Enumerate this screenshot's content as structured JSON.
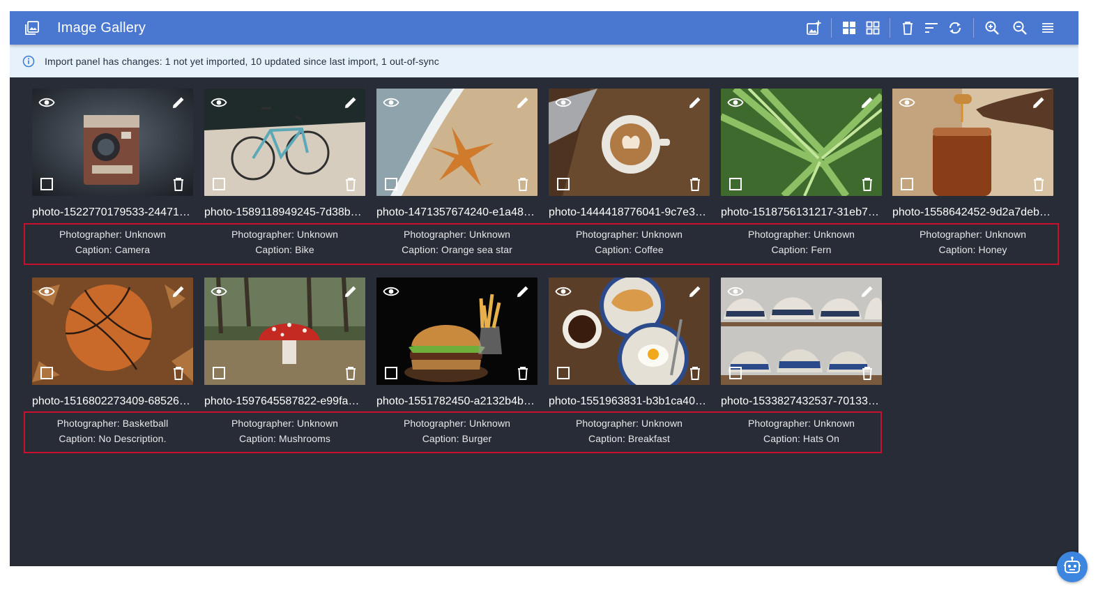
{
  "app": {
    "title": "Image Gallery",
    "icon": "image-library-icon",
    "accent_color": "#4a78d0",
    "background_color": "#282c36"
  },
  "toolbar": {
    "buttons": [
      {
        "name": "add-image-button",
        "icon": "add-photo-icon"
      },
      {
        "name": "large-grid-button",
        "icon": "grid-large-icon"
      },
      {
        "name": "small-grid-button",
        "icon": "grid-small-icon"
      },
      {
        "name": "delete-button",
        "icon": "trash-icon"
      },
      {
        "name": "sort-button",
        "icon": "sort-icon"
      },
      {
        "name": "sync-button",
        "icon": "sync-icon"
      },
      {
        "name": "zoom-in-button",
        "icon": "zoom-in-icon"
      },
      {
        "name": "zoom-out-button",
        "icon": "zoom-out-icon"
      },
      {
        "name": "menu-button",
        "icon": "hamburger-menu-icon"
      }
    ]
  },
  "banner": {
    "icon": "info-icon",
    "text": "Import panel has changes: 1 not yet imported, 10 updated since last import, 1 out-of-sync",
    "background_color": "#e6f1fb"
  },
  "images": [
    {
      "filename": "photo-1522770179533-24471f…",
      "photographer": "Photographer: Unknown",
      "caption": "Caption: Camera",
      "subject": "camera"
    },
    {
      "filename": "photo-1589118949245-7d38b…",
      "photographer": "Photographer: Unknown",
      "caption": "Caption: Bike",
      "subject": "bike"
    },
    {
      "filename": "photo-1471357674240-e1a48…",
      "photographer": "Photographer: Unknown",
      "caption": "Caption: Orange sea star",
      "subject": "sea-star"
    },
    {
      "filename": "photo-1444418776041-9c7e3…",
      "photographer": "Photographer: Unknown",
      "caption": "Caption: Coffee",
      "subject": "coffee"
    },
    {
      "filename": "photo-1518756131217-31eb7…",
      "photographer": "Photographer: Unknown",
      "caption": "Caption: Fern",
      "subject": "fern"
    },
    {
      "filename": "photo-1558642452-9d2a7deb…",
      "photographer": "Photographer: Unknown",
      "caption": "Caption: Honey",
      "subject": "honey"
    },
    {
      "filename": "photo-1516802273409-68526…",
      "photographer": "Photographer: Basketball",
      "caption": "Caption: No Description.",
      "subject": "basketball"
    },
    {
      "filename": "photo-1597645587822-e99fa5…",
      "photographer": "Photographer: Unknown",
      "caption": "Caption: Mushrooms",
      "subject": "mushroom"
    },
    {
      "filename": "photo-1551782450-a2132b4b…",
      "photographer": "Photographer: Unknown",
      "caption": "Caption: Burger",
      "subject": "burger"
    },
    {
      "filename": "photo-1551963831-b3b1ca40…",
      "photographer": "Photographer: Unknown",
      "caption": "Caption: Breakfast",
      "subject": "breakfast"
    },
    {
      "filename": "photo-1533827432537-70133…",
      "photographer": "Photographer: Unknown",
      "caption": "Caption: Hats On",
      "subject": "hats"
    }
  ],
  "tile_overlay_icons": [
    "eye-icon",
    "pencil-icon",
    "checkbox-icon",
    "trash-icon"
  ],
  "highlight_color": "#c8102e",
  "assistant": {
    "icon": "robot-assistant-icon"
  }
}
